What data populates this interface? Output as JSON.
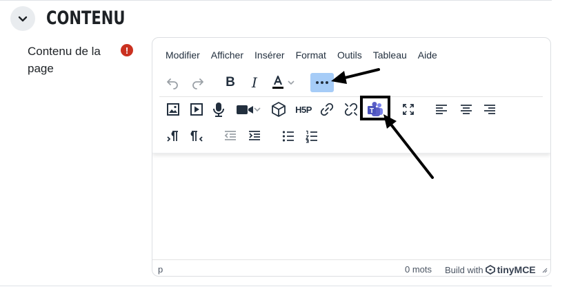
{
  "section": {
    "title": "CONTENU",
    "collapse_icon": "chevron-down-icon"
  },
  "field": {
    "label": "Contenu de la page",
    "required_icon": "exclamation-icon",
    "required_color": "#ca3120"
  },
  "editor": {
    "menu": [
      "Modifier",
      "Afficher",
      "Insérer",
      "Format",
      "Outils",
      "Tableau",
      "Aide"
    ],
    "toolbar_row1": [
      "undo-icon",
      "redo-icon",
      "bold-icon",
      "italic-icon",
      "text-color-icon",
      "chevron-down-icon",
      "more-icon"
    ],
    "toolbar_row2": [
      "image-icon",
      "media-icon",
      "microphone-icon",
      "video-icon",
      "chevron-down-icon",
      "package-icon",
      "h5p-icon",
      "link-icon",
      "unlink-icon",
      "teams-icon",
      "fullscreen-icon",
      "align-left-icon",
      "align-center-icon",
      "align-right-icon"
    ],
    "toolbar_row3": [
      "ltr-icon",
      "rtl-icon",
      "outdent-icon",
      "indent-icon",
      "bullet-list-icon",
      "numbered-list-icon"
    ],
    "h5p_label": "H5P",
    "teams_letter": "T",
    "more_highlight_color": "#a6ccf7",
    "teams_color": "#5b5fc7",
    "status": {
      "path": "p",
      "word_count": "0 mots",
      "build_with": "Build with",
      "brand": "tinyMCE"
    }
  }
}
